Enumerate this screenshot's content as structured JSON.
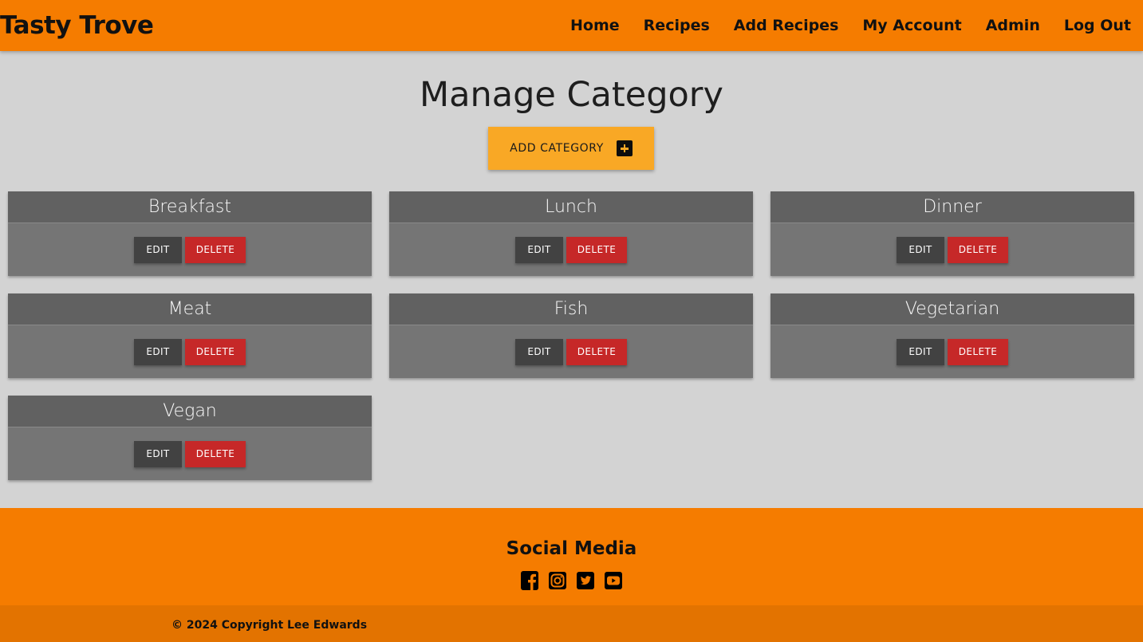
{
  "nav": {
    "brand": "Tasty Trove",
    "links": [
      "Home",
      "Recipes",
      "Add Recipes",
      "My Account",
      "Admin",
      "Log Out"
    ]
  },
  "main": {
    "title": "Manage Category",
    "add_button_label": "ADD CATEGORY",
    "add_button_icon": "plus-square-icon",
    "categories": [
      {
        "name": "Breakfast",
        "edit_label": "EDIT",
        "delete_label": "DELETE"
      },
      {
        "name": "Lunch",
        "edit_label": "EDIT",
        "delete_label": "DELETE"
      },
      {
        "name": "Dinner",
        "edit_label": "EDIT",
        "delete_label": "DELETE"
      },
      {
        "name": "Meat",
        "edit_label": "EDIT",
        "delete_label": "DELETE"
      },
      {
        "name": "Fish",
        "edit_label": "EDIT",
        "delete_label": "DELETE"
      },
      {
        "name": "Vegetarian",
        "edit_label": "EDIT",
        "delete_label": "DELETE"
      },
      {
        "name": "Vegan",
        "edit_label": "EDIT",
        "delete_label": "DELETE"
      }
    ]
  },
  "footer": {
    "title": "Social Media",
    "social_icons": [
      "facebook-icon",
      "instagram-icon",
      "twitter-icon",
      "youtube-icon"
    ],
    "copyright": "© 2024 Copyright Lee Edwards"
  },
  "colors": {
    "nav_bg": "#f57c00",
    "page_bg": "#d3d3d3",
    "add_button": "#f9a825",
    "card_body": "#757575",
    "card_header": "#616161",
    "edit_button": "#424242",
    "delete_button": "#c62828",
    "copyright_bar": "#e37300"
  }
}
